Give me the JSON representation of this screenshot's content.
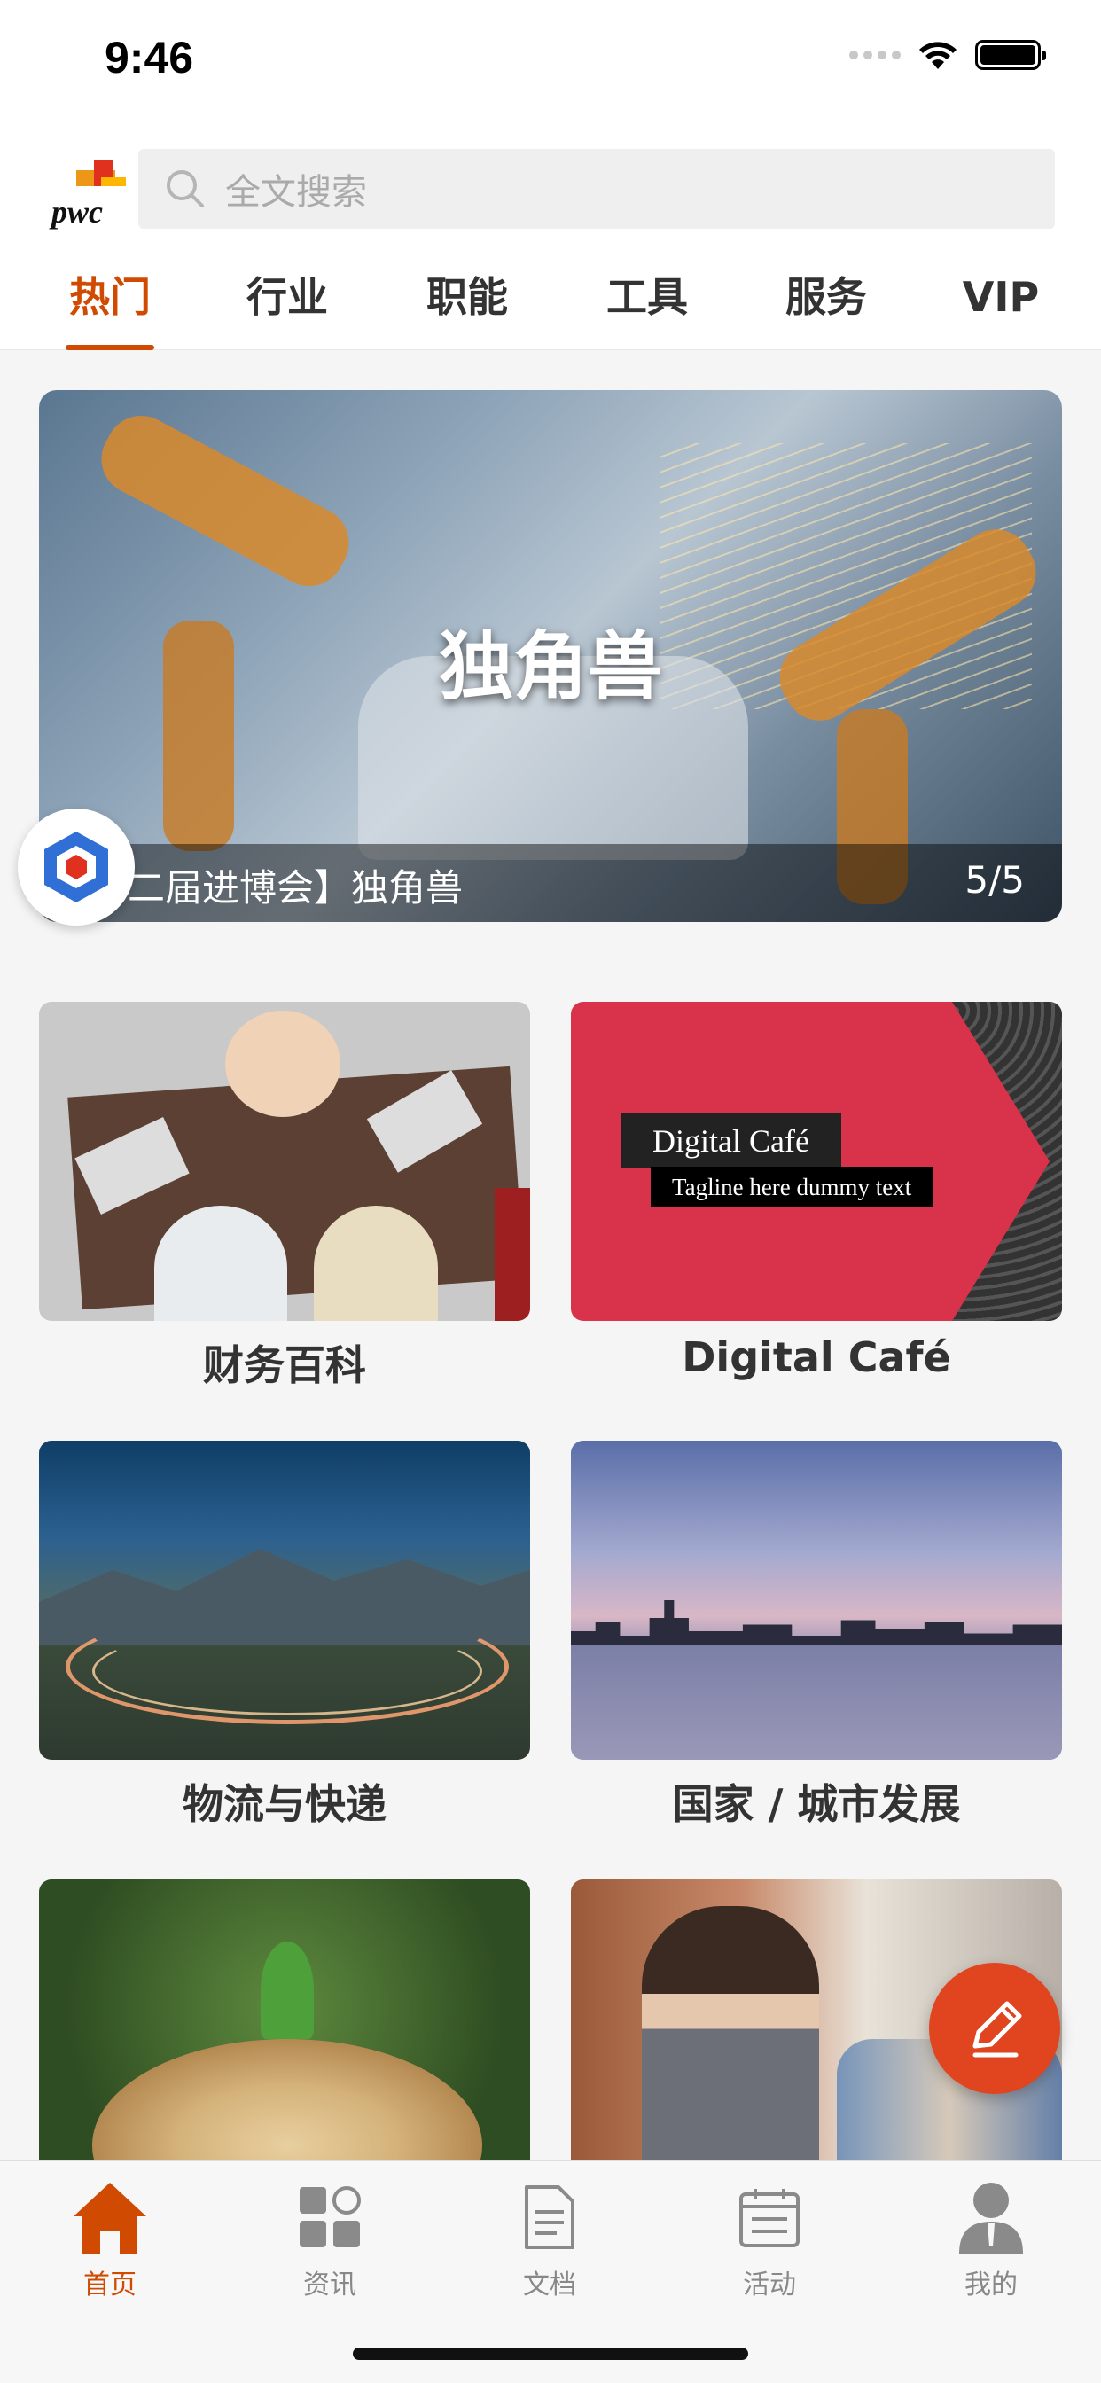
{
  "status_bar": {
    "time": "9:46"
  },
  "header": {
    "logo_text": "pwc",
    "search": {
      "placeholder": "全文搜索"
    },
    "tabs": [
      {
        "label": "热门",
        "active": true
      },
      {
        "label": "行业",
        "active": false
      },
      {
        "label": "职能",
        "active": false
      },
      {
        "label": "工具",
        "active": false
      },
      {
        "label": "服务",
        "active": false
      },
      {
        "label": "VIP",
        "active": false
      }
    ]
  },
  "banner": {
    "title": "独角兽",
    "caption": "二届进博会】独角兽",
    "page_indicator": "5/5"
  },
  "cards": [
    {
      "label": "财务百科"
    },
    {
      "label": "Digital Café",
      "image_title": "Digital Café",
      "image_tagline": "Tagline here dummy text"
    },
    {
      "label": "物流与快递"
    },
    {
      "label": "国家 / 城市发展"
    },
    {
      "label": ""
    },
    {
      "label": ""
    }
  ],
  "bottom_nav": [
    {
      "label": "首页",
      "icon": "home-icon",
      "active": true
    },
    {
      "label": "资讯",
      "icon": "news-icon",
      "active": false
    },
    {
      "label": "文档",
      "icon": "document-icon",
      "active": false
    },
    {
      "label": "活动",
      "icon": "calendar-icon",
      "active": false
    },
    {
      "label": "我的",
      "icon": "profile-icon",
      "active": false
    }
  ],
  "colors": {
    "accent": "#d04a02",
    "fab": "#e0451f",
    "digital_cafe_red": "#d8334a"
  }
}
